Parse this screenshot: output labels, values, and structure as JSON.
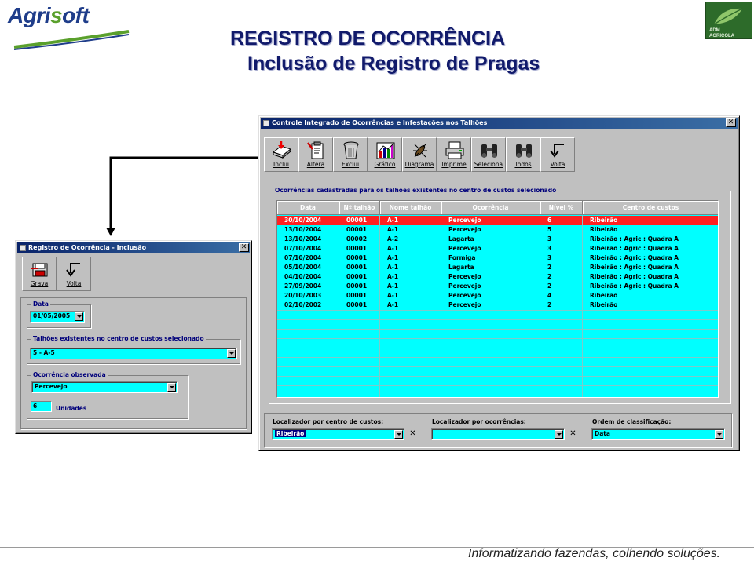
{
  "brand": {
    "logo_prefix": "Agri",
    "logo_accent": "s",
    "logo_suffix": "oft",
    "badge_line1": "ADM",
    "badge_line2": "AGRICOLA",
    "color_navy": "#1f3d8a",
    "color_green": "#5aa02c"
  },
  "slide": {
    "title": "REGISTRO DE OCORRÊNCIA",
    "subtitle": "Inclusão de Registro de Pragas",
    "footer": "Informatizando fazendas, colhendo soluções."
  },
  "main_window": {
    "title": "Controle Integrado de Ocorrências e Infestações nos Talhões",
    "close_label": "✕",
    "toolbar": [
      {
        "label": "Inclui",
        "icon": "new-record-icon"
      },
      {
        "label": "Altera",
        "icon": "edit-clipboard-icon"
      },
      {
        "label": "Exclui",
        "icon": "trash-can-icon"
      },
      {
        "label": "Gráfico",
        "icon": "bar-chart-icon"
      },
      {
        "label": "Diagrama",
        "icon": "insect-icon"
      },
      {
        "label": "Imprime",
        "icon": "printer-icon"
      },
      {
        "label": "Seleciona",
        "icon": "binoculars-icon"
      },
      {
        "label": "Todos",
        "icon": "binoculars-icon"
      },
      {
        "label": "Volta",
        "icon": "return-arrow-icon"
      }
    ],
    "group_label": "Ocorrências cadastradas para os talhões existentes no centro de custos selecionado",
    "columns": [
      "Data",
      "Nº talhão",
      "Nome talhão",
      "Ocorrência",
      "Nível %",
      "Centro de custos"
    ],
    "rows": [
      [
        "30/10/2004",
        "00001",
        "A-1",
        "Percevejo",
        "6",
        "Ribeirão"
      ],
      [
        "13/10/2004",
        "00001",
        "A-1",
        "Percevejo",
        "5",
        "Ribeirão"
      ],
      [
        "13/10/2004",
        "00002",
        "A-2",
        "Lagarta",
        "3",
        "Ribeirão : Agric : Quadra A"
      ],
      [
        "07/10/2004",
        "00001",
        "A-1",
        "Percevejo",
        "3",
        "Ribeirão : Agric : Quadra A"
      ],
      [
        "07/10/2004",
        "00001",
        "A-1",
        "Formiga",
        "3",
        "Ribeirão : Agric : Quadra A"
      ],
      [
        "05/10/2004",
        "00001",
        "A-1",
        "Lagarta",
        "2",
        "Ribeirão : Agric : Quadra A"
      ],
      [
        "04/10/2004",
        "00001",
        "A-1",
        "Percevejo",
        "2",
        "Ribeirão : Agric : Quadra A"
      ],
      [
        "27/09/2004",
        "00001",
        "A-1",
        "Percevejo",
        "2",
        "Ribeirão : Agric : Quadra A"
      ],
      [
        "20/10/2003",
        "00001",
        "A-1",
        "Percevejo",
        "4",
        "Ribeirão"
      ],
      [
        "02/10/2002",
        "00001",
        "A-1",
        "Percevejo",
        "2",
        "Ribeirão"
      ]
    ],
    "selected_row_index": 0,
    "colors": {
      "grid_bg": "#00ffff",
      "selected_row": "#ff2020",
      "title_bar": "#0a246a"
    },
    "filters": {
      "cost_center_label": "Localizador por centro de custos:",
      "cost_center_value": "Ribeirão",
      "occurrence_label": "Localizador por ocorrências:",
      "occurrence_value": "",
      "sort_label": "Ordem de classificação:",
      "sort_value": "Data",
      "clear_label": "✕"
    }
  },
  "dialog": {
    "title": "Registro de Ocorrência - Inclusão",
    "close_label": "✕",
    "toolbar": [
      {
        "label": "Grava",
        "icon": "save-record-icon"
      },
      {
        "label": "Volta",
        "icon": "return-arrow-icon"
      }
    ],
    "date_label": "Data",
    "date_value": "01/05/2005",
    "plot_label": "Talhões existentes no centro de custos selecionado",
    "plot_value": "5 - A-5",
    "occurrence_label": "Ocorrência observada",
    "occurrence_value": "Percevejo",
    "quantity_value": "6",
    "quantity_unit": "Unidades"
  }
}
